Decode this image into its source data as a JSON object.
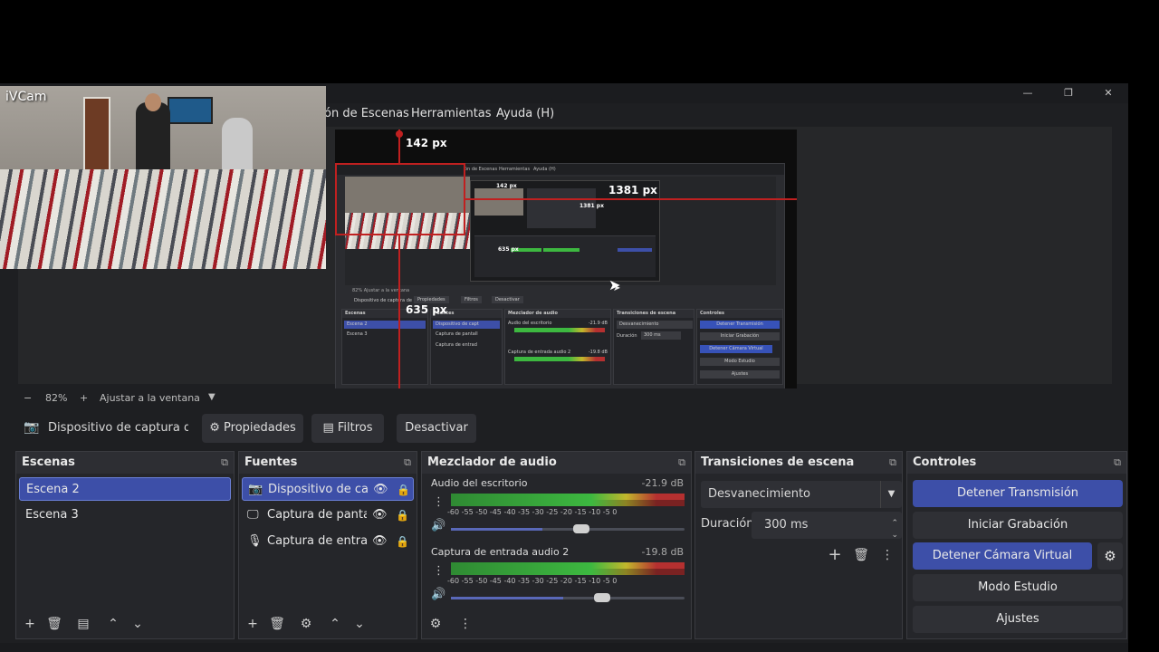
{
  "window": {
    "minimize": "—",
    "restore": "❐",
    "close": "✕"
  },
  "menu": {
    "items": [
      "ón de Escenas",
      "Herramientas",
      "Ayuda (H)"
    ]
  },
  "webcam": {
    "label": "iVCam"
  },
  "preview": {
    "measure_top": "142 px",
    "measure_right": "1381 px",
    "measure_bottom": "635 px",
    "nested": {
      "menu": [
        "ón de Escenas",
        "Herramientas",
        "Ayuda (H)"
      ],
      "measure_top": "142 px",
      "measure_right": "1381 px",
      "measure_bottom": "635 px",
      "zoom_text": "82%   Ajustar a la ventana",
      "ctx": [
        "Dispositivo de captura de",
        "Propiedades",
        "Filtros",
        "Desactivar"
      ],
      "panels": [
        "Escenas",
        "Fuentes",
        "Mezclador de audio",
        "Transiciones de escena",
        "Controles"
      ],
      "scenes": [
        "Escena 2",
        "Escena 3"
      ],
      "sources": [
        "Dispositivo de capt",
        "Captura de pantall",
        "Captura de entrad"
      ],
      "audio": [
        "Audio del escritorio",
        "Captura de entrada audio 2"
      ],
      "audio_db": [
        "-21.9 dB",
        "-19.8 dB"
      ],
      "transition": "Desvanecimiento",
      "duration_label": "Duración",
      "duration": "300 ms",
      "controls": [
        "Detener Transmisión",
        "Iniciar Grabación",
        "Detener Cámara Virtual",
        "Modo Estudio",
        "Ajustes"
      ]
    }
  },
  "zoom": {
    "minus": "−",
    "value": "82%",
    "plus": "+",
    "fit": "Ajustar a la ventana"
  },
  "context": {
    "source_name": "Dispositivo de captura de v",
    "properties": "Propiedades",
    "filters": "Filtros",
    "deactivate": "Desactivar"
  },
  "scenes": {
    "title": "Escenas",
    "items": [
      "Escena 2",
      "Escena 3"
    ]
  },
  "sources": {
    "title": "Fuentes",
    "items": [
      "Dispositivo de capt",
      "Captura de pantalli",
      "Captura de entrad:"
    ]
  },
  "mixer": {
    "title": "Mezclador de audio",
    "channels": [
      {
        "name": "Audio del escritorio",
        "db": "-21.9 dB",
        "level": 0.39
      },
      {
        "name": "Captura de entrada audio 2",
        "db": "-19.8 dB",
        "level": 0.48
      }
    ],
    "scale": [
      "-60",
      "-55",
      "-50",
      "-45",
      "-40",
      "-35",
      "-30",
      "-25",
      "-20",
      "-15",
      "-10",
      "-5",
      "0"
    ]
  },
  "transitions": {
    "title": "Transiciones de escena",
    "selected": "Desvanecimiento",
    "duration_label": "Duración",
    "duration": "300 ms"
  },
  "controls": {
    "title": "Controles",
    "stop_stream": "Detener Transmisión",
    "start_recording": "Iniciar Grabación",
    "stop_virtual_cam": "Detener Cámara Virtual",
    "studio_mode": "Modo Estudio",
    "settings": "Ajustes"
  },
  "colors": {
    "accent": "#3d4fa8",
    "guide_red": "#c02020",
    "panel_bg": "#25262a",
    "window_bg": "#1e1f22"
  }
}
